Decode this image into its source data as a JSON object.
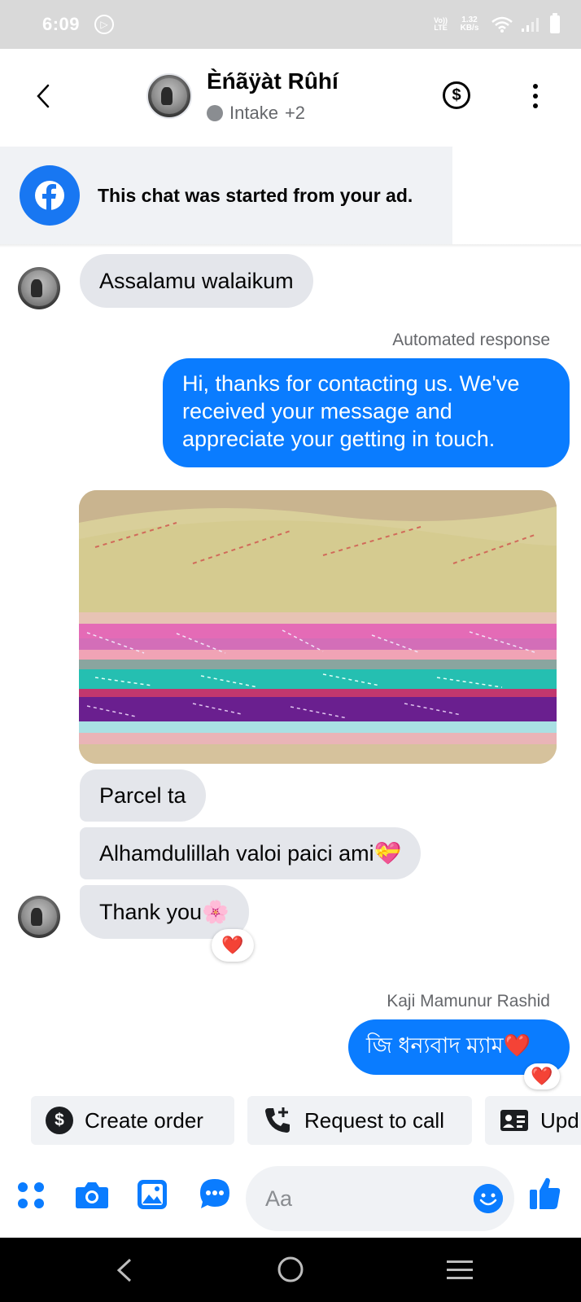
{
  "status_bar": {
    "time": "6:09",
    "network_label": "Vo)) LTE",
    "speed": "1.32 KB/s"
  },
  "header": {
    "contact_name": "Èńãÿàt Rûhí",
    "subtitle": "Intake",
    "subtitle_extra": "+2"
  },
  "ad_banner": {
    "text": "This chat was started from your ad."
  },
  "messages": {
    "m1": "Assalamu walaikum",
    "automated_label": "Automated response",
    "m2": "Hi, thanks for contacting us. We've received your message and appreciate your getting in touch.",
    "m3": "Parcel ta",
    "m4": "Alhamdulillah valoi  paici ami💝",
    "m5": "Thank you🌸",
    "sender_label": "Kaji Mamunur Rashid",
    "m6": "জি ধন্যবাদ ম্যাম❤️"
  },
  "reactions": {
    "r1": "❤️",
    "r2": "❤️"
  },
  "quick_replies": [
    {
      "label": "Create order",
      "icon": "dollar-circle-icon"
    },
    {
      "label": "Request to call",
      "icon": "phone-plus-icon"
    },
    {
      "label": "Upd",
      "icon": "contact-card-icon"
    }
  ],
  "composer": {
    "placeholder": "Aa"
  },
  "colors": {
    "messenger_blue": "#0a7cff",
    "incoming_bubble": "#e4e6eb",
    "facebook_blue": "#1877f2"
  }
}
